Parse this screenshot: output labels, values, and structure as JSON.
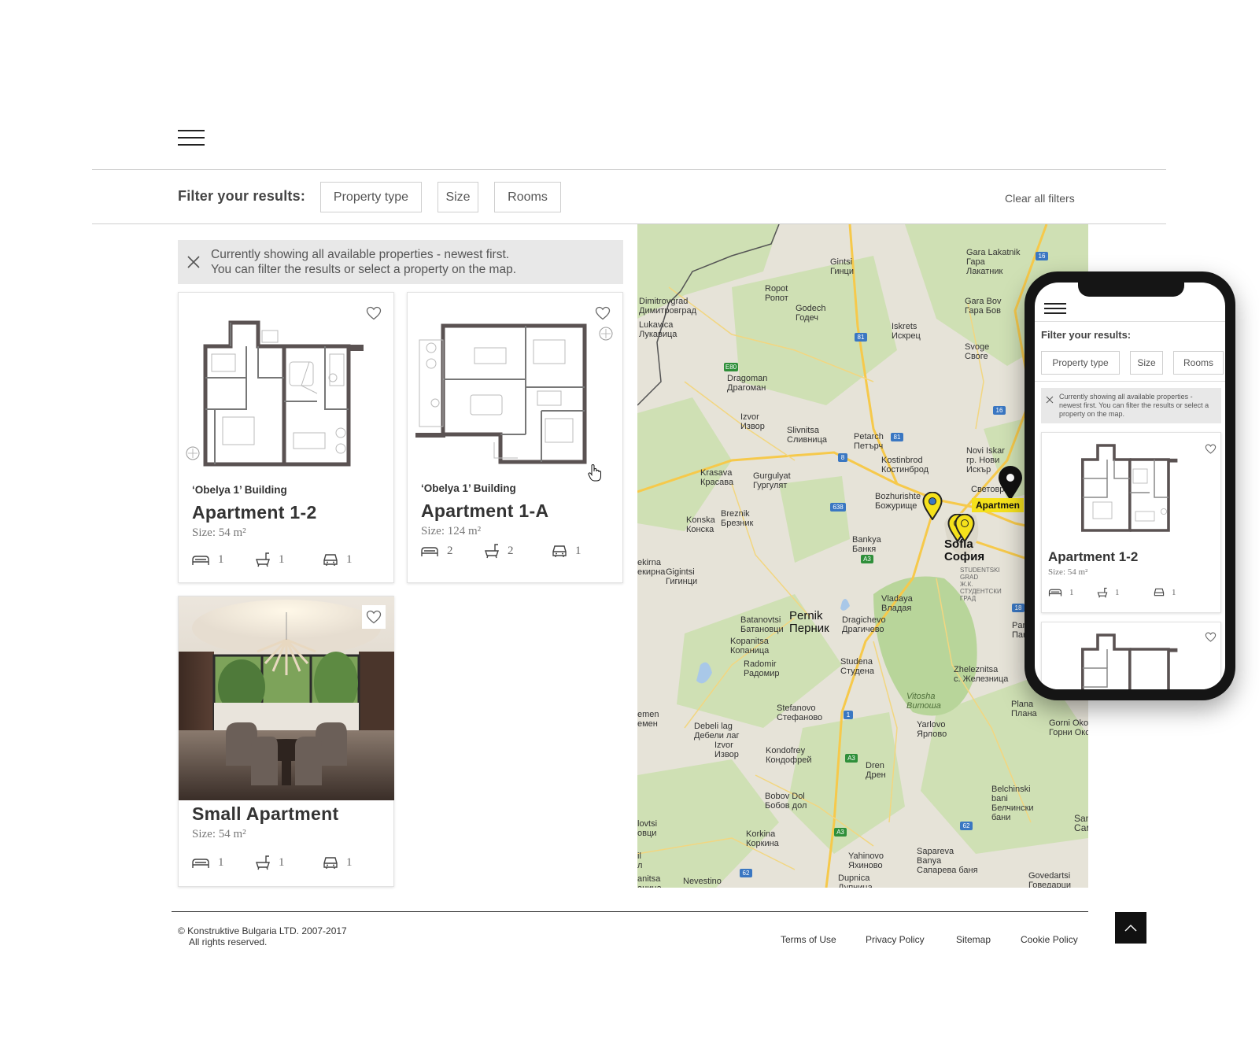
{
  "filter": {
    "label": "Filter your results:",
    "chips": [
      "Property type",
      "Size",
      "Rooms"
    ],
    "clear_all": "Clear all filters"
  },
  "notice": {
    "line1": "Currently showing all available properties - newest first.",
    "line2": "You can filter the results or select a property on the map."
  },
  "listings": [
    {
      "building": "‘Obelya 1’ Building",
      "title": "Apartment 1-2",
      "size": "Size: 54 m²",
      "beds": "1",
      "baths": "1",
      "parking": "1"
    },
    {
      "building": "‘Obelya 1’ Building",
      "title": "Apartment 1-A",
      "size": "Size: 124 m²",
      "beds": "2",
      "baths": "2",
      "parking": "1"
    },
    {
      "building": "",
      "title": "Small Apartment",
      "size": "Size: 54 m²",
      "beds": "1",
      "baths": "1",
      "parking": "1"
    }
  ],
  "map": {
    "labels": {
      "gintsi": "Gintsi\nГинци",
      "gara_lakatnik": "Gara Lakatnik\nГара\nЛакатник",
      "dimitrovgrad": "Dimitrovgrad\nДимитровград",
      "ropot": "Ropot\nРопот",
      "godech": "Godech\nГодеч",
      "lukavica": "Lukavica\nЛукавица",
      "iskrets": "Iskrets\nИскрец",
      "gara_bov": "Gara Bov\nГара Бов",
      "svoge": "Svoge\nСвоге",
      "dragoman": "Dragoman\nДрагоман",
      "izvor1": "Izvor\nИзвор",
      "slivnitsa": "Slivnitsa\nСливница",
      "petarch": "Petarch\nПетърч",
      "kostinbrod": "Kostinbrod\nКостинброд",
      "novi_iskar": "Novi Iskar\nгр. Нови\nИскър",
      "krasava": "Krasava\nКрасава",
      "gurgulyat": "Gurgulyat\nГургулят",
      "bozhurishte": "Bozhurishte\nБожурище",
      "svetovrachene": "Световра",
      "breznik": "Breznik\nБрезник",
      "konska": "Konska\nКонска",
      "bankya": "Bankya\nБанкя",
      "sofia": "Sofia\nСофия",
      "studentski": "STUDENTSKI\nGRAD\nЖ.К.\nСТУДЕНТСКИ\nГРАД",
      "ekirna": "ekirna\nекирна",
      "gigintsi": "Gigintsi\nГигинци",
      "vladaya": "Vladaya\nВладая",
      "batanovtsi": "Batanovtsi\nБатановци",
      "pernik": "Pernik\nПерник",
      "dragichevo": "Dragichevo\nДрагичево",
      "pancharevo": "Panchar\nПанчар",
      "kopanitsa": "Kopanitsa\nКопаница",
      "radomir": "Radomir\nРадомир",
      "studena": "Studena\nСтудена",
      "zheleznitsa": "Zheleznitsa\nс. Железница",
      "vitosha": "Vitosha\nВитоша",
      "plana": "Plana\nПлана",
      "stefanovo": "Stefanovo\nСтефаново",
      "emen": "emen\nемен",
      "debeli_lag": "Debeli lag\nДебели лаг",
      "yarlovo": "Yarlovo\nЯрлово",
      "gorni_okol": "Gorni Oko\nГорни Око",
      "izvor2": "Izvor\nИзвор",
      "kondofrey": "Kondofrey\nКондофрей",
      "dren": "Dren\nДрен",
      "bobov_dol": "Bobov Dol\nБобов дол",
      "belchinski": "Belchinski\nbani\nБелчински\nбани",
      "lovtsi": "lovtsi\nовци",
      "korkina": "Korkina\nКоркина",
      "sam": "Sam\nСам",
      "yahinovo": "Yahinovo\nЯхиново",
      "sapareva": "Sapareva\nBanya\nСапарева баня",
      "il": "il\nл",
      "anitsa": "anitsa\nаница",
      "nevestino": "Nevestino",
      "dupnica": "Dupnica\nДупница",
      "govedartsi": "Govedartsi\nГоведарци"
    },
    "road_badges": [
      "16",
      "81",
      "E80",
      "81",
      "8",
      "638",
      "16",
      "A3",
      "1",
      "A3",
      "A3",
      "62",
      "62",
      "1",
      "16",
      "18"
    ],
    "callout": "Apartmen"
  },
  "footer": {
    "copyright_line1": "© Konstruktive Bulgaria LTD. 2007-2017",
    "copyright_line2": "All rights reserved.",
    "links": [
      "Terms of Use",
      "Privacy Policy",
      "Sitemap",
      "Cookie Policy"
    ]
  },
  "mobile": {
    "filter_label": "Filter your results:",
    "chips": [
      "Property type",
      "Size",
      "Rooms"
    ],
    "notice": "Currently showing all available properties - newest first. You can filter the results or select a property on the map.",
    "card": {
      "title": "Apartment 1-2",
      "size": "Size: 54 m²",
      "beds": "1",
      "baths": "1",
      "parking": "1"
    }
  },
  "colors": {
    "map_land": "#e6e3d8",
    "map_forest": "#cfe0b4",
    "map_park": "#b8d59a",
    "map_road_major": "#f6c94b",
    "map_road_minor": "#f2d680",
    "map_border": "#555555",
    "marker_yellow": "#f5e11b",
    "marker_black": "#111111"
  }
}
